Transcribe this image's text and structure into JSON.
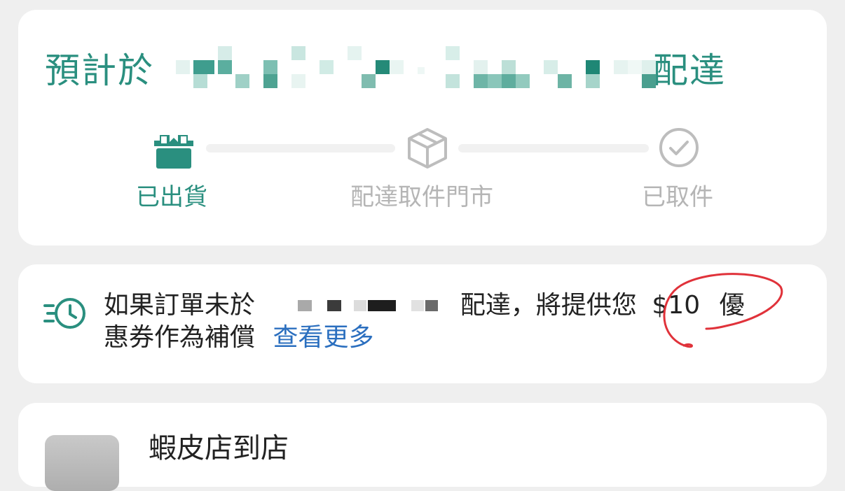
{
  "delivery_estimate": {
    "prefix": "預計於",
    "suffix": "配達",
    "date_redacted": true
  },
  "progress": {
    "steps": [
      {
        "label": "已出貨",
        "state": "active",
        "icon": "shipped-box-icon"
      },
      {
        "label": "配達取件門市",
        "state": "pending",
        "icon": "box-icon"
      },
      {
        "label": "已取件",
        "state": "pending",
        "icon": "check-circle-icon"
      }
    ]
  },
  "notice": {
    "text_before_redaction": "如果訂單未於",
    "text_after_redaction": "配達，將提供您",
    "amount": "$10",
    "text_line2_start": "優",
    "text_line2": "惠券作為補償",
    "link_label": "查看更多",
    "icon": "fast-clock-icon"
  },
  "store": {
    "name": "蝦皮店到店"
  },
  "colors": {
    "accent": "#2a8f7f",
    "link": "#2b6fbf",
    "annotation": "#e0323a"
  }
}
